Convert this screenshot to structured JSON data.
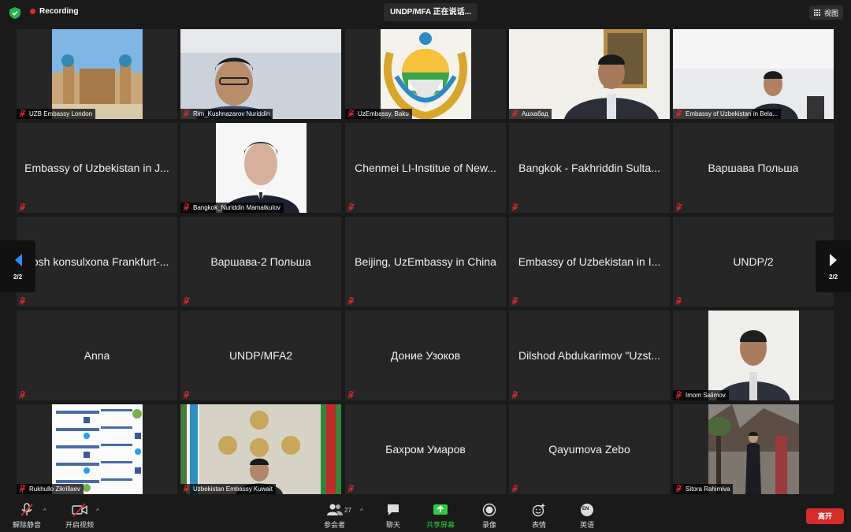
{
  "topbar": {
    "recording_label": "Recording",
    "active_speaker": "UNDP/MFA 正在说话...",
    "view_label": "视图"
  },
  "pager": {
    "left_page": "2/2",
    "right_page": "2/2"
  },
  "tiles": [
    {
      "name": "UZB Embassy London",
      "type": "video"
    },
    {
      "name": "Rim_Kushnazarov Nuriddin",
      "type": "video"
    },
    {
      "name": "UzEmbassy, Baku",
      "type": "video"
    },
    {
      "name": "Ашхабад",
      "type": "video"
    },
    {
      "name": "Embassy of Uzbekistan in Bela...",
      "type": "video"
    },
    {
      "name": "Embassy of Uzbekistan in J...",
      "type": "text"
    },
    {
      "name": "Bangkok_Nuriddin Mamatkulov",
      "type": "video"
    },
    {
      "name": "Chenmei LI-Institue of New...",
      "type": "text"
    },
    {
      "name": "Bangkok - Fakhriddin Sulta...",
      "type": "text"
    },
    {
      "name": "Варшава Польша",
      "type": "text"
    },
    {
      "name": "Bosh konsulxona Frankfurt-...",
      "type": "text"
    },
    {
      "name": "Варшава-2 Польша",
      "type": "text"
    },
    {
      "name": "Beijing, UzEmbassy in China",
      "type": "text"
    },
    {
      "name": "Embassy of Uzbekistan in I...",
      "type": "text"
    },
    {
      "name": "UNDP/2",
      "type": "text"
    },
    {
      "name": "Anna",
      "type": "text"
    },
    {
      "name": "UNDP/MFA2",
      "type": "text"
    },
    {
      "name": "Доние Узоков",
      "type": "text"
    },
    {
      "name": "Dilshod Abdukarimov \"Uzst...",
      "type": "text"
    },
    {
      "name": "Imom Salimov",
      "type": "video"
    },
    {
      "name": "Rukhullo Zikrillaev",
      "type": "video"
    },
    {
      "name": "Uzbekistan Embassy Kuwait",
      "type": "video"
    },
    {
      "name": "Бахром Умаров",
      "type": "text"
    },
    {
      "name": "Qayumova Zebo",
      "type": "text"
    },
    {
      "name": "Sitora Rahimiva",
      "type": "video"
    }
  ],
  "toolbar": {
    "unmute": "解除静音",
    "start_video": "开启视频",
    "participants": "参会者",
    "participants_count": "27",
    "chat": "聊天",
    "share_screen": "共享屏幕",
    "record": "录像",
    "reactions": "表情",
    "language": "英语",
    "language_badge": "EN",
    "leave": "离开"
  },
  "colors": {
    "share_green": "#2ecc40",
    "leave_red": "#d62b2b",
    "mute_red": "#e02828"
  }
}
